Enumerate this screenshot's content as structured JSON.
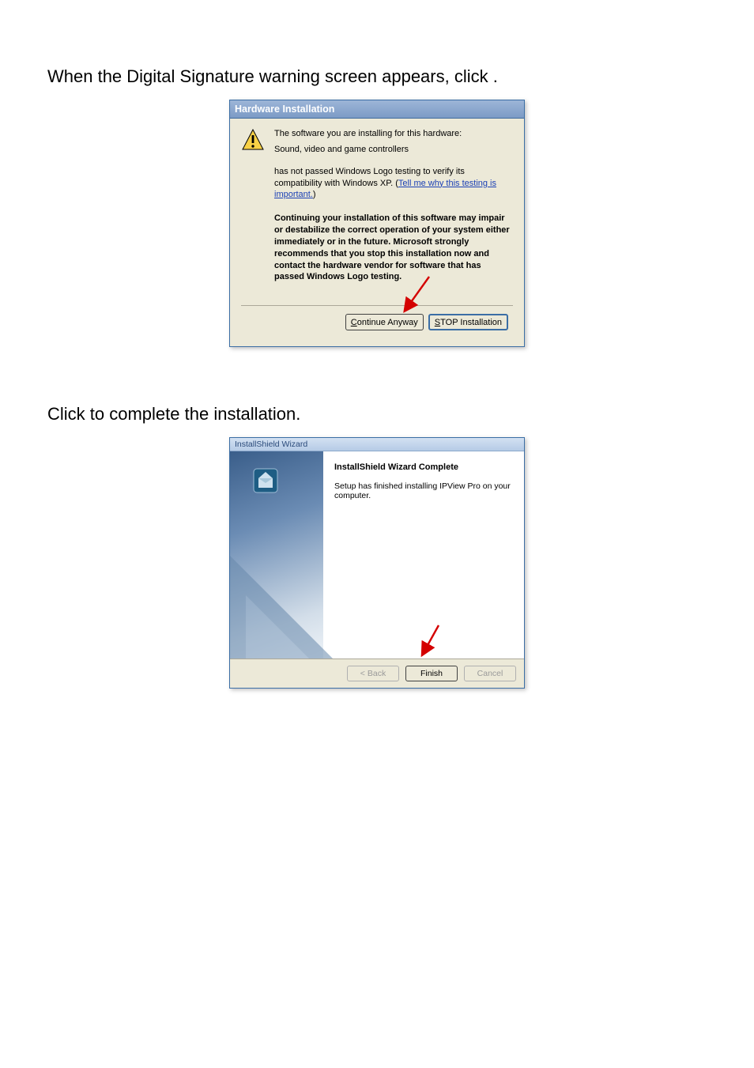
{
  "instruction1_prefix": "When the Digital Signature warning screen appears, click ",
  "instruction1_suffix": ".",
  "instruction2_prefix": "Click ",
  "instruction2_suffix": " to complete the installation.",
  "dialog1": {
    "title": "Hardware Installation",
    "line1": "The software you are installing for this hardware:",
    "line2": "Sound, video and game controllers",
    "line3_a": "has not passed Windows Logo testing to verify its compatibility with Windows XP. (",
    "line3_link": "Tell me why this testing is important.",
    "line3_b": ")",
    "bold_warning": "Continuing your installation of this software may impair or destabilize the correct operation of your system either immediately or in the future. Microsoft strongly recommends that you stop this installation now and contact the hardware vendor for software that has passed Windows Logo testing.",
    "btn_continue": "Continue Anyway",
    "btn_stop": "STOP Installation"
  },
  "dialog2": {
    "title": "InstallShield Wizard",
    "heading": "InstallShield Wizard Complete",
    "desc": "Setup has finished installing IPView Pro on your computer.",
    "btn_back": "< Back",
    "btn_finish": "Finish",
    "btn_cancel": "Cancel"
  }
}
